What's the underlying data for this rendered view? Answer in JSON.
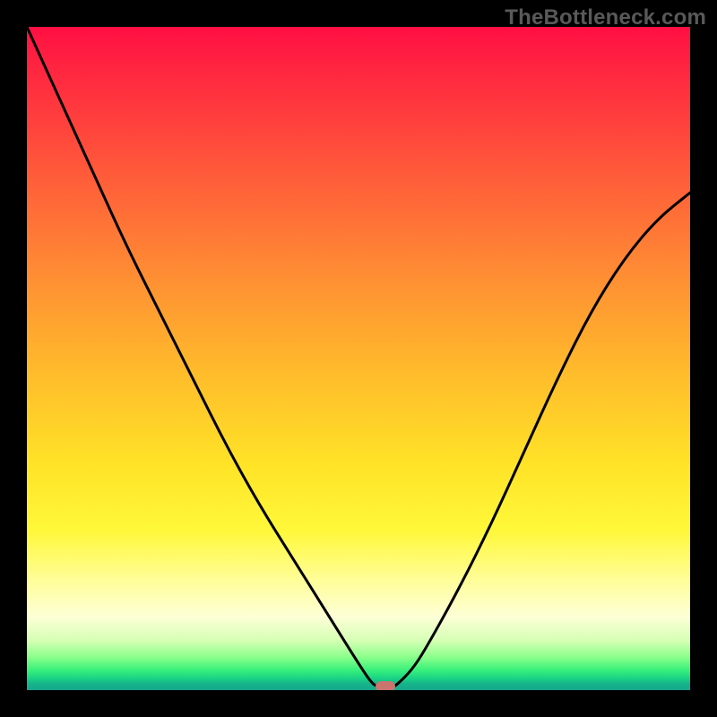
{
  "watermark": "TheBottleneck.com",
  "chart_data": {
    "type": "line",
    "title": "",
    "xlabel": "",
    "ylabel": "",
    "xlim": [
      0,
      100
    ],
    "ylim": [
      0,
      100
    ],
    "grid": false,
    "legend": false,
    "series": [
      {
        "name": "bottleneck-curve",
        "x": [
          0,
          5,
          10,
          15,
          20,
          25,
          30,
          35,
          40,
          45,
          50,
          52,
          53,
          54,
          55,
          56,
          58,
          60,
          65,
          70,
          75,
          80,
          85,
          90,
          95,
          100
        ],
        "values": [
          100,
          89,
          78,
          67,
          57,
          47,
          37,
          28,
          20,
          12,
          4,
          1,
          0.5,
          0,
          0.3,
          1,
          3,
          6,
          15,
          25,
          36,
          47,
          57,
          65,
          71,
          75
        ]
      }
    ],
    "minimum_point": {
      "x": 54,
      "y": 0
    },
    "minimum_marker_color": "#c9746e",
    "gradient_stops": [
      {
        "pct": 0,
        "color": "#ff0f43"
      },
      {
        "pct": 22,
        "color": "#ff5a3a"
      },
      {
        "pct": 52,
        "color": "#ffbb2b"
      },
      {
        "pct": 76,
        "color": "#fff83a"
      },
      {
        "pct": 89,
        "color": "#fdffd6"
      },
      {
        "pct": 95,
        "color": "#8cff8b"
      },
      {
        "pct": 100,
        "color": "#15a78c"
      }
    ]
  }
}
